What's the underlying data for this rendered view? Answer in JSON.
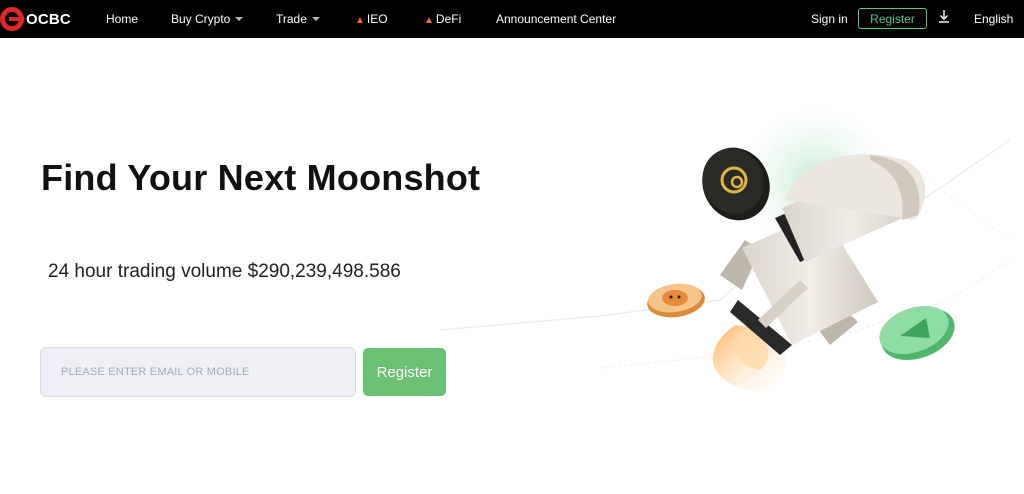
{
  "nav": {
    "logo_text": "OCBC",
    "items": [
      {
        "label": "Home"
      },
      {
        "label": "Buy Crypto"
      },
      {
        "label": "Trade"
      },
      {
        "label": "IEO"
      },
      {
        "label": "DeFi"
      },
      {
        "label": "Announcement Center"
      }
    ],
    "sign_in": "Sign in",
    "register": "Register",
    "language": "English"
  },
  "hero": {
    "headline": "Find Your Next Moonshot",
    "volume_text": "24 hour trading volume $290,239,498.586",
    "email_placeholder": "PLEASE ENTER EMAIL OR MOBILE",
    "register_button": "Register"
  },
  "colors": {
    "brand_red": "#e02626",
    "accent_green": "#58c686",
    "register_button_green": "#6cc074"
  }
}
